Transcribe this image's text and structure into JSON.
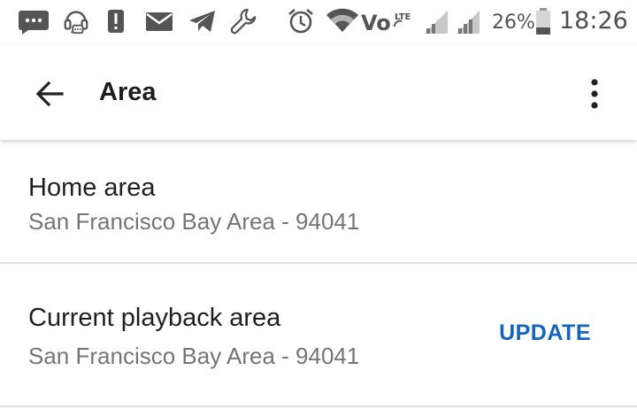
{
  "status_bar": {
    "battery_percent": "26%",
    "time": "18:26",
    "icons": [
      "message-icon",
      "headset-notification-icon",
      "alert-icon",
      "mail-icon",
      "telegram-icon",
      "wrench-icon",
      "alarm-icon",
      "wifi-icon",
      "volte-icon",
      "signal-icon",
      "signal-icon",
      "battery-icon"
    ]
  },
  "app_bar": {
    "title": "Area",
    "back_icon": "arrow-back-icon",
    "overflow_icon": "more-vert-icon"
  },
  "list": {
    "home_area": {
      "title": "Home area",
      "subtitle": "San Francisco Bay Area - 94041"
    },
    "current_playback_area": {
      "title": "Current playback area",
      "subtitle": "San Francisco Bay Area - 94041",
      "action_label": "UPDATE"
    }
  },
  "colors": {
    "accent": "#1565c0",
    "title_text": "#1f1f1f",
    "secondary_text": "#757575",
    "divider": "#e3e3e3",
    "status_icons": "#555555"
  }
}
